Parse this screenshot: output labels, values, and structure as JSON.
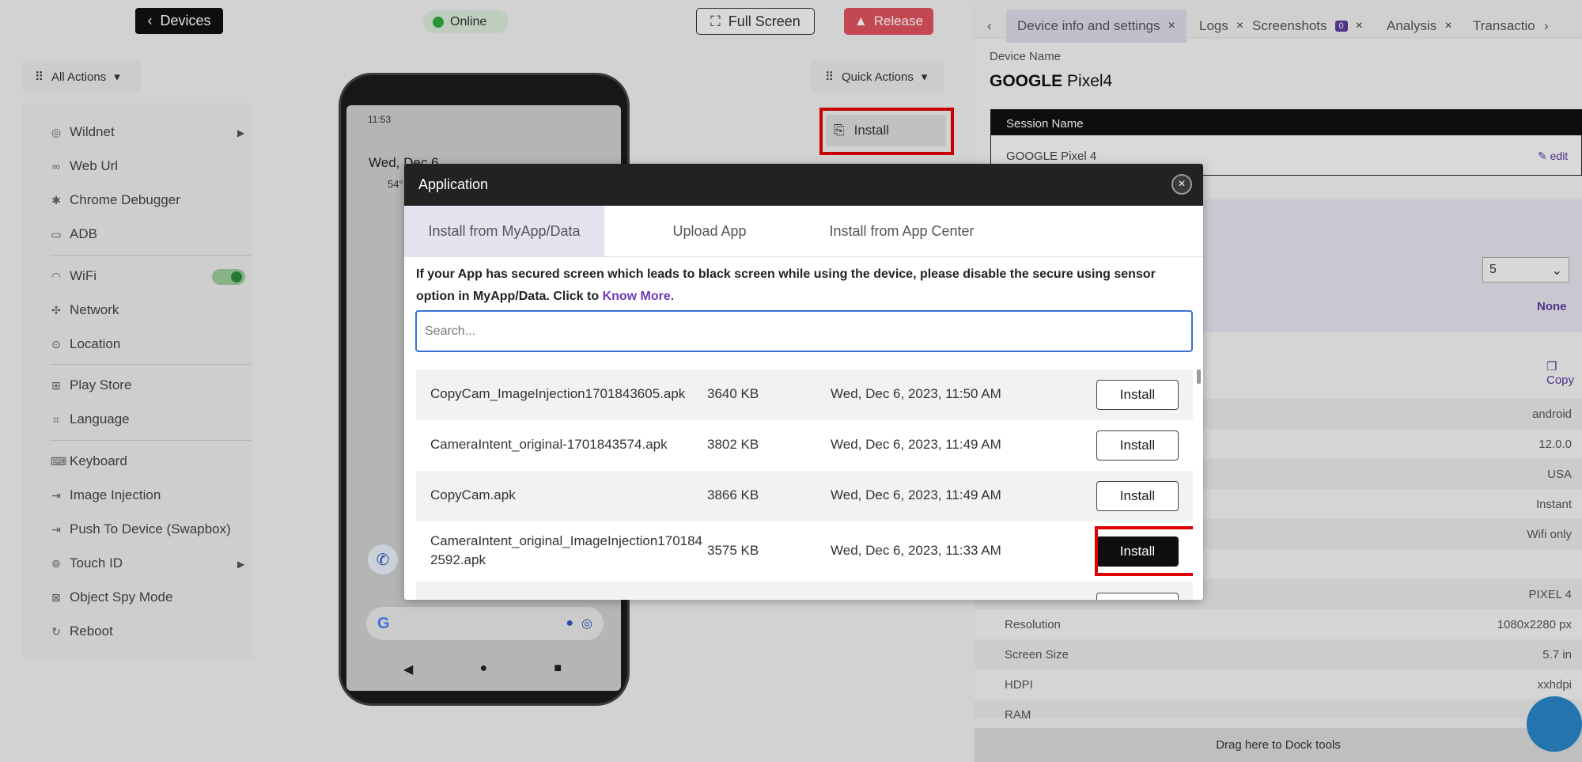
{
  "topbar": {
    "devices_label": "Devices",
    "status_label": "Online",
    "fullscreen_label": "Full Screen",
    "release_label": "Release"
  },
  "left_menu": {
    "all_actions_label": "All Actions",
    "items": [
      {
        "label": "Wildnet",
        "icon": "wildnet-icon"
      },
      {
        "label": "Web Url",
        "icon": "link-icon"
      },
      {
        "label": "Chrome Debugger",
        "icon": "bug-icon"
      },
      {
        "label": "ADB",
        "icon": "terminal-icon"
      },
      {
        "label": "WiFi",
        "icon": "wifi-icon"
      },
      {
        "label": "Network",
        "icon": "network-icon"
      },
      {
        "label": "Location",
        "icon": "location-pin-icon"
      },
      {
        "label": "Play Store",
        "icon": "grid-icon"
      },
      {
        "label": "Language",
        "icon": "language-icon"
      },
      {
        "label": "Keyboard",
        "icon": "keyboard-icon"
      },
      {
        "label": "Image Injection",
        "icon": "image-injection-icon"
      },
      {
        "label": "Push To Device (Swapbox)",
        "icon": "push-icon"
      },
      {
        "label": "Touch ID",
        "icon": "fingerprint-icon"
      },
      {
        "label": "Object Spy Mode",
        "icon": "spy-icon"
      },
      {
        "label": "Reboot",
        "icon": "reboot-icon"
      }
    ]
  },
  "phone": {
    "status_time": "11:53",
    "date": "Wed, Dec 6",
    "temp": "54°"
  },
  "quick_actions": {
    "label": "Quick Actions",
    "install_label": "Install"
  },
  "right_panel": {
    "tabs": [
      {
        "label": "Device info and settings"
      },
      {
        "label": "Logs"
      },
      {
        "label": "Screenshots",
        "badge": "0"
      },
      {
        "label": "Analysis"
      },
      {
        "label": "Transactio"
      }
    ],
    "device_name_label": "Device Name",
    "device_brand": "GOOGLE",
    "device_model": "Pixel4",
    "session_name_label": "Session Name",
    "session_name_value": "GOOGLE Pixel 4",
    "session_edit_label": "edit",
    "select_value": "5",
    "none_value": "None",
    "copy_label": "Copy",
    "properties": [
      {
        "key": "",
        "value": "android"
      },
      {
        "key": "",
        "value": "12.0.0"
      },
      {
        "key": "",
        "value": "USA"
      },
      {
        "key": "",
        "value": "Instant"
      },
      {
        "key": "",
        "value": "Wifi only"
      },
      {
        "key": "",
        "value": ""
      },
      {
        "key": "",
        "value": "PIXEL 4"
      },
      {
        "key": "Resolution",
        "value": "1080x2280 px"
      },
      {
        "key": "Screen Size",
        "value": "5.7 in"
      },
      {
        "key": "HDPI",
        "value": "xxhdpi"
      },
      {
        "key": "RAM",
        "value": ""
      }
    ],
    "drag_label": "Drag here to Dock tools"
  },
  "modal": {
    "title": "Application",
    "tabs": [
      "Install from MyApp/Data",
      "Upload App",
      "Install from App Center"
    ],
    "notice_text": "If your App has secured screen which leads to black screen while using the device, please disable the secure using sensor option in MyApp/Data. Click to ",
    "notice_link": "Know More.",
    "search_placeholder": "Search...",
    "install_label": "Install",
    "apps": [
      {
        "name": "CopyCam_ImageInjection1701843605.apk",
        "size": "3640 KB",
        "date": "Wed, Dec 6, 2023, 11:50 AM"
      },
      {
        "name": "CameraIntent_original-1701843574.apk",
        "size": "3802 KB",
        "date": "Wed, Dec 6, 2023, 11:49 AM"
      },
      {
        "name": "CopyCam.apk",
        "size": "3866 KB",
        "date": "Wed, Dec 6, 2023, 11:49 AM"
      },
      {
        "name": "CameraIntent_original_ImageInjection1701842592.apk",
        "name_line1": "CameraIntent_original_ImageInjection170184",
        "name_line2": "2592.apk",
        "size": "3575 KB",
        "date": "Wed, Dec 6, 2023, 11:33 AM"
      }
    ]
  }
}
